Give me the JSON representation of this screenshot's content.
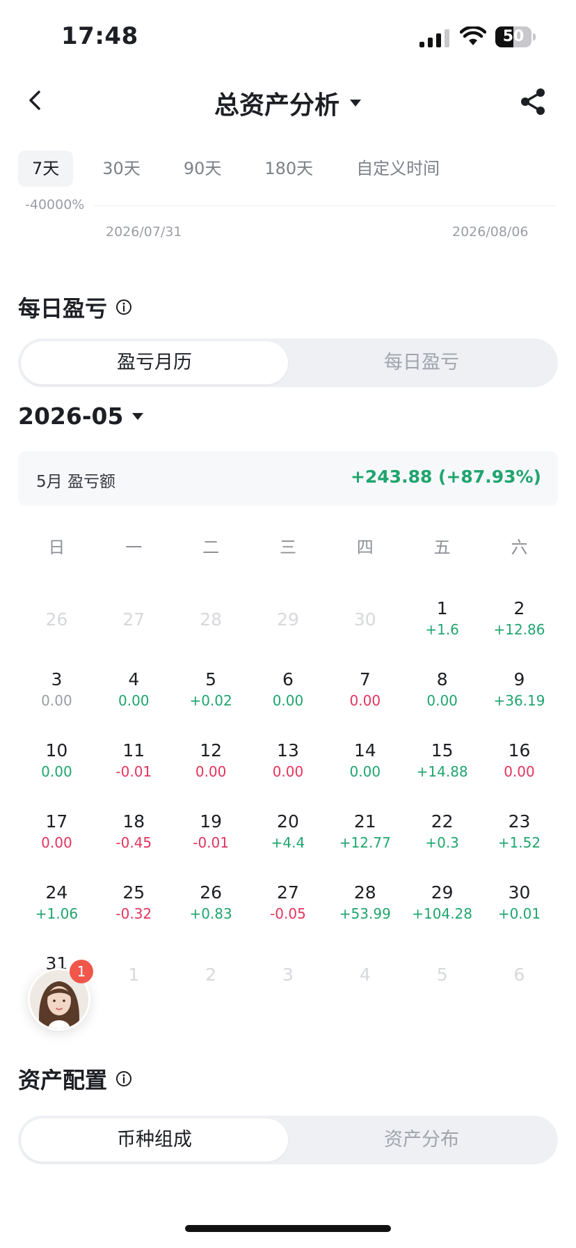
{
  "status": {
    "time": "17:48",
    "battery": "50",
    "battery_level": 0.5
  },
  "nav": {
    "title": "总资产分析"
  },
  "range_tabs": [
    {
      "label": "7天",
      "active": true
    },
    {
      "label": "30天",
      "active": false
    },
    {
      "label": "90天",
      "active": false
    },
    {
      "label": "180天",
      "active": false
    },
    {
      "label": "自定义时间",
      "active": false
    }
  ],
  "chart": {
    "axis_label": "-40000%",
    "date_start": "2026/07/31",
    "date_end": "2026/08/06"
  },
  "daily_pnl": {
    "title": "每日盈亏",
    "tabs": [
      "盈亏月历",
      "每日盈亏"
    ],
    "active_tab": 0,
    "month": "2026-05",
    "summary_label": "5月 盈亏额",
    "summary_value": "+243.88 (+87.93%)"
  },
  "calendar": {
    "weekdays": [
      "日",
      "一",
      "二",
      "三",
      "四",
      "五",
      "六"
    ],
    "days": [
      {
        "num": "26",
        "pnl": "",
        "state": "muted"
      },
      {
        "num": "27",
        "pnl": "",
        "state": "muted"
      },
      {
        "num": "28",
        "pnl": "",
        "state": "muted"
      },
      {
        "num": "29",
        "pnl": "",
        "state": "muted"
      },
      {
        "num": "30",
        "pnl": "",
        "state": "muted"
      },
      {
        "num": "1",
        "pnl": "+1.6",
        "state": "green"
      },
      {
        "num": "2",
        "pnl": "+12.86",
        "state": "green"
      },
      {
        "num": "3",
        "pnl": "0.00",
        "state": "gray"
      },
      {
        "num": "4",
        "pnl": "0.00",
        "state": "green"
      },
      {
        "num": "5",
        "pnl": "+0.02",
        "state": "green"
      },
      {
        "num": "6",
        "pnl": "0.00",
        "state": "green"
      },
      {
        "num": "7",
        "pnl": "0.00",
        "state": "red"
      },
      {
        "num": "8",
        "pnl": "0.00",
        "state": "green"
      },
      {
        "num": "9",
        "pnl": "+36.19",
        "state": "green"
      },
      {
        "num": "10",
        "pnl": "0.00",
        "state": "green"
      },
      {
        "num": "11",
        "pnl": "-0.01",
        "state": "red"
      },
      {
        "num": "12",
        "pnl": "0.00",
        "state": "red"
      },
      {
        "num": "13",
        "pnl": "0.00",
        "state": "red"
      },
      {
        "num": "14",
        "pnl": "0.00",
        "state": "green"
      },
      {
        "num": "15",
        "pnl": "+14.88",
        "state": "green"
      },
      {
        "num": "16",
        "pnl": "0.00",
        "state": "red"
      },
      {
        "num": "17",
        "pnl": "0.00",
        "state": "red"
      },
      {
        "num": "18",
        "pnl": "-0.45",
        "state": "red"
      },
      {
        "num": "19",
        "pnl": "-0.01",
        "state": "red"
      },
      {
        "num": "20",
        "pnl": "+4.4",
        "state": "green"
      },
      {
        "num": "21",
        "pnl": "+12.77",
        "state": "green"
      },
      {
        "num": "22",
        "pnl": "+0.3",
        "state": "green"
      },
      {
        "num": "23",
        "pnl": "+1.52",
        "state": "green"
      },
      {
        "num": "24",
        "pnl": "+1.06",
        "state": "green"
      },
      {
        "num": "25",
        "pnl": "-0.32",
        "state": "red"
      },
      {
        "num": "26",
        "pnl": "+0.83",
        "state": "green"
      },
      {
        "num": "27",
        "pnl": "-0.05",
        "state": "red"
      },
      {
        "num": "28",
        "pnl": "+53.99",
        "state": "green"
      },
      {
        "num": "29",
        "pnl": "+104.28",
        "state": "green"
      },
      {
        "num": "30",
        "pnl": "+0.01",
        "state": "green"
      },
      {
        "num": "31",
        "pnl": "",
        "state": "normal"
      },
      {
        "num": "1",
        "pnl": "",
        "state": "muted"
      },
      {
        "num": "2",
        "pnl": "",
        "state": "muted"
      },
      {
        "num": "3",
        "pnl": "",
        "state": "muted"
      },
      {
        "num": "4",
        "pnl": "",
        "state": "muted"
      },
      {
        "num": "5",
        "pnl": "",
        "state": "muted"
      },
      {
        "num": "6",
        "pnl": "",
        "state": "muted"
      }
    ]
  },
  "support": {
    "badge": "1"
  },
  "allocation": {
    "title": "资产配置",
    "tabs": [
      "币种组成",
      "资产分布"
    ],
    "active_tab": 0
  },
  "colors": {
    "green": "#1fa56e",
    "red": "#e3345d",
    "gray": "#9a9da5"
  }
}
